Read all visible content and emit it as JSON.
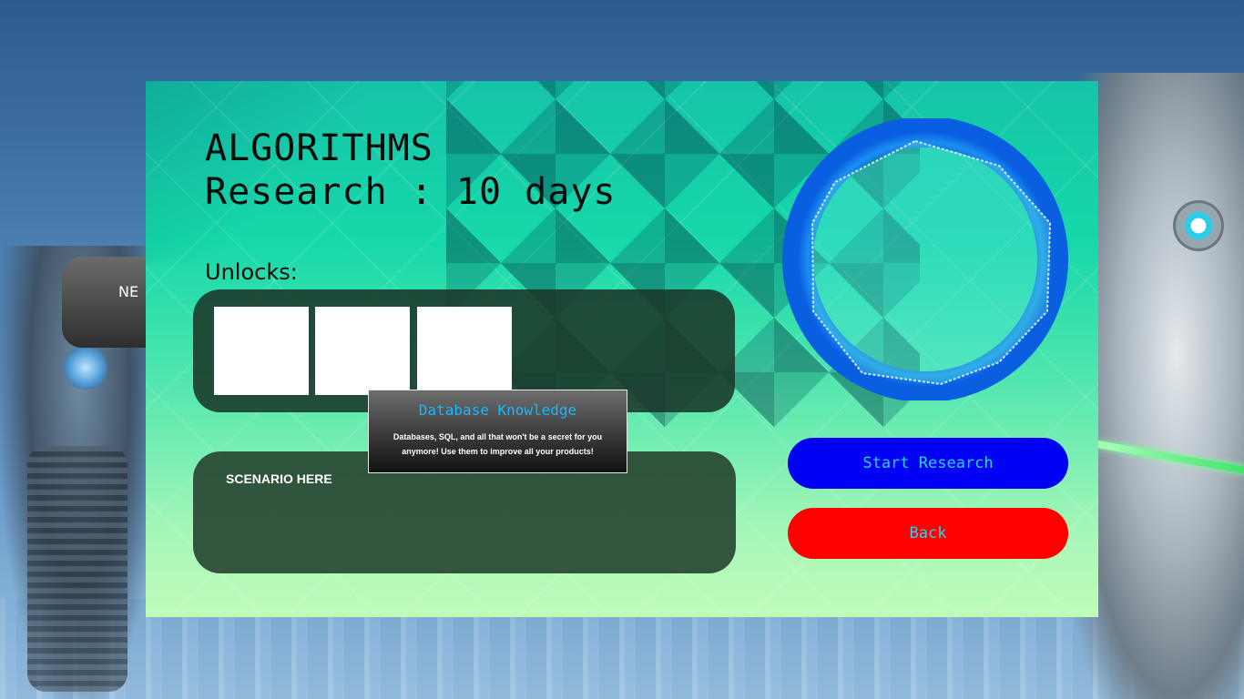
{
  "research": {
    "name": "ALGORITHMS",
    "duration": "Research : 10 days"
  },
  "unlocks": {
    "label": "Unlocks:",
    "slot_count": 3
  },
  "tooltip": {
    "title": "Database Knowledge",
    "description": "Databases, SQL, and all that won't be a secret for you anymore! Use them to improve all your products!"
  },
  "scenario": {
    "text": "SCENARIO HERE"
  },
  "buttons": {
    "start_research": "Start Research",
    "back": "Back"
  },
  "background": {
    "partial_button_label": "NE"
  },
  "colors": {
    "start_button": "#0000f5",
    "back_button": "#ff0000",
    "button_text": "#22d6f0",
    "tooltip_title": "#16b8ff",
    "ring": "#0a6fe0"
  }
}
